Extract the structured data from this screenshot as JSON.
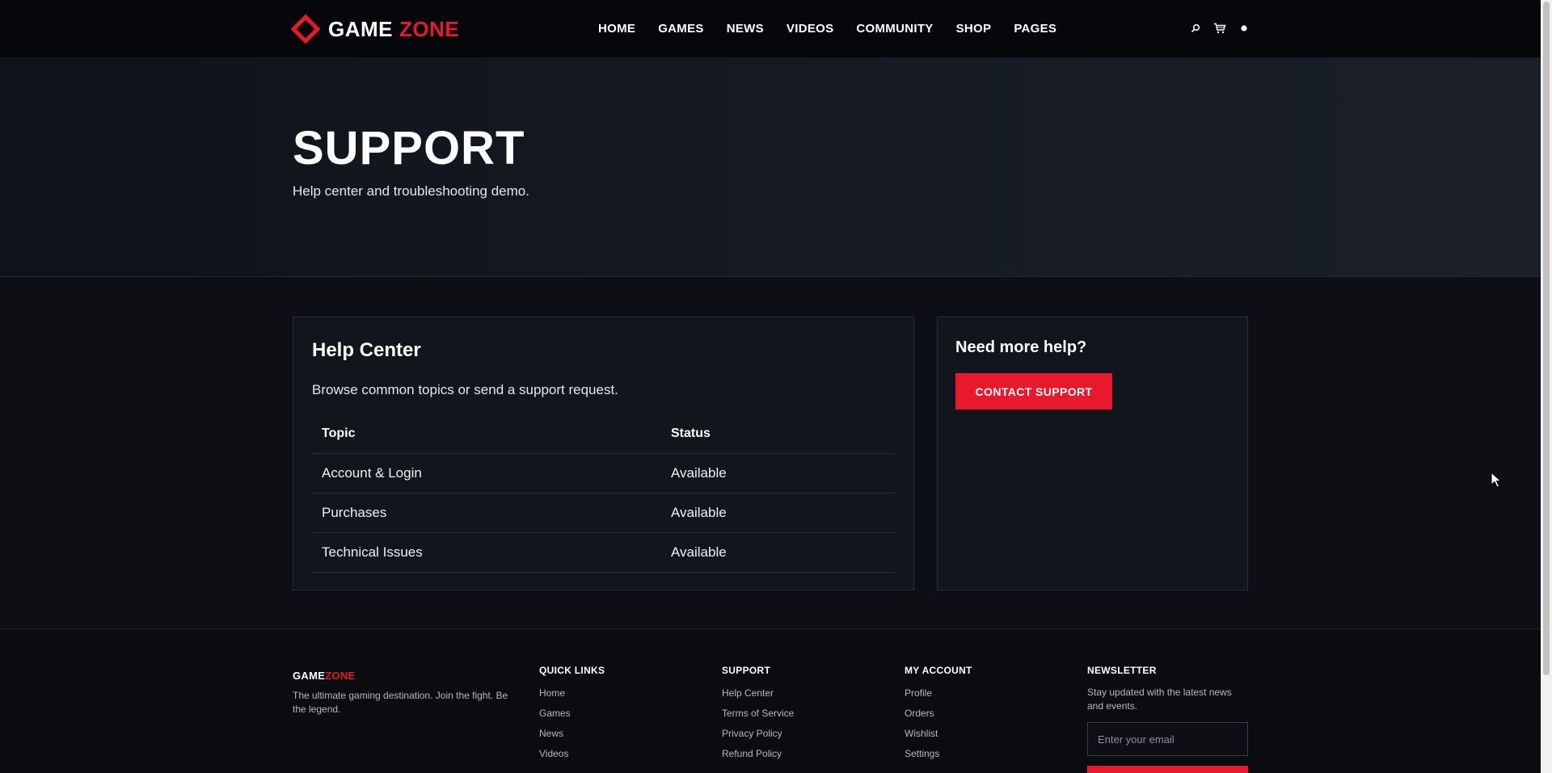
{
  "header": {
    "logo_primary": "GAME",
    "logo_accent": "ZONE",
    "nav": [
      "HOME",
      "GAMES",
      "NEWS",
      "VIDEOS",
      "COMMUNITY",
      "SHOP",
      "PAGES"
    ],
    "icons": [
      "search-icon",
      "cart-icon",
      "user-icon"
    ]
  },
  "hero": {
    "title": "SUPPORT",
    "subtitle": "Help center and troubleshooting demo."
  },
  "help_center": {
    "title": "Help Center",
    "description": "Browse common topics or send a support request.",
    "columns": [
      "Topic",
      "Status"
    ],
    "rows": [
      {
        "topic": "Account & Login",
        "status": "Available"
      },
      {
        "topic": "Purchases",
        "status": "Available"
      },
      {
        "topic": "Technical Issues",
        "status": "Available"
      }
    ]
  },
  "sidebar": {
    "title": "Need more help?",
    "button_label": "CONTACT SUPPORT"
  },
  "footer": {
    "brand_primary": "GAME",
    "brand_accent": "ZONE",
    "tagline": "The ultimate gaming destination. Join the fight. Be the legend.",
    "quick_links": {
      "title": "QUICK LINKS",
      "items": [
        "Home",
        "Games",
        "News",
        "Videos"
      ]
    },
    "support": {
      "title": "SUPPORT",
      "items": [
        "Help Center",
        "Terms of Service",
        "Privacy Policy",
        "Refund Policy"
      ]
    },
    "my_account": {
      "title": "MY ACCOUNT",
      "items": [
        "Profile",
        "Orders",
        "Wishlist",
        "Settings"
      ]
    },
    "newsletter": {
      "title": "NEWSLETTER",
      "text": "Stay updated with the latest news and events.",
      "placeholder": "Enter your email"
    }
  },
  "colors": {
    "accent": "#e8192c",
    "background": "#0d0f14",
    "card": "#12151b"
  }
}
